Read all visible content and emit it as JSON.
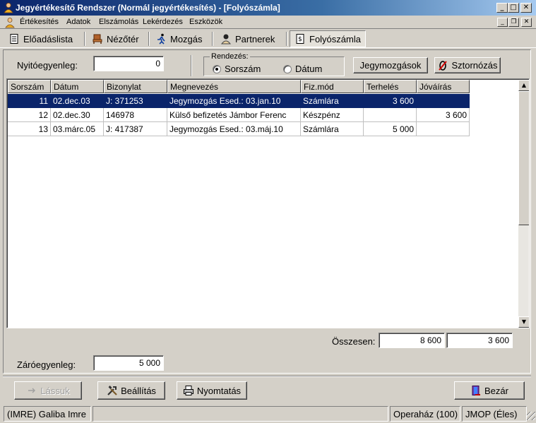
{
  "window": {
    "title": "Jegyértékesítő Rendszer (Normál jegyértékesítés) - [Folyószámla]",
    "minimize": "_",
    "maximize": "□",
    "close": "✕"
  },
  "menu": {
    "items": [
      "Értékesítés",
      "Adatok",
      "Elszámolás",
      "Lekérdezés",
      "Eszközök"
    ],
    "mdi_minimize": "_",
    "mdi_restore": "❐",
    "mdi_close": "✕"
  },
  "tabs": [
    {
      "label": "Előadáslista",
      "icon": "document-list-icon"
    },
    {
      "label": "Nézőtér",
      "icon": "chair-icon"
    },
    {
      "label": "Mozgás",
      "icon": "running-man-icon"
    },
    {
      "label": "Partnerek",
      "icon": "person-icon"
    },
    {
      "label": "Folyószámla",
      "icon": "ledger-icon",
      "active": true
    }
  ],
  "opening_balance": {
    "label": "Nyitóegyenleg:",
    "value": "0"
  },
  "sort": {
    "legend": "Rendezés:",
    "options": [
      {
        "label": "Sorszám",
        "checked": true
      },
      {
        "label": "Dátum",
        "checked": false
      }
    ]
  },
  "buttons": {
    "ticket_movements": "Jegymozgások",
    "reversal": "Sztornózás",
    "view": "Lássuk",
    "settings": "Beállítás",
    "print": "Nyomtatás",
    "close": "Bezár"
  },
  "table": {
    "columns": [
      "Sorszám",
      "Dátum",
      "Bizonylat",
      "Megnevezés",
      "Fiz.mód",
      "Terhelés",
      "Jóváírás"
    ],
    "rows": [
      {
        "no": "11",
        "date": "02.dec.03",
        "doc": "J: 371253",
        "name": "Jegymozgás Esed.: 03.jan.10",
        "pay": "Számlára",
        "debit": "3 600",
        "credit": "",
        "selected": true
      },
      {
        "no": "12",
        "date": "02.dec.30",
        "doc": "146978",
        "name": "Külső befizetés Jámbor Ferenc",
        "pay": "Készpénz",
        "debit": "",
        "credit": "3 600",
        "selected": false
      },
      {
        "no": "13",
        "date": "03.márc.05",
        "doc": "J: 417387",
        "name": "Jegymozgás Esed.: 03.máj.10",
        "pay": "Számlára",
        "debit": "5 000",
        "credit": "",
        "selected": false
      }
    ]
  },
  "totals": {
    "label": "Összesen:",
    "debit": "8 600",
    "credit": "3 600"
  },
  "closing_balance": {
    "label": "Záróegyenleg:",
    "value": "5 000"
  },
  "status": {
    "user": "(IMRE) Galiba Imre",
    "empty": "",
    "venue": "Operaház (100)",
    "mode": "JMOP (Éles)"
  },
  "colors": {
    "selection": "#0a246a",
    "face": "#d4d0c8",
    "title_start": "#0a246a"
  }
}
